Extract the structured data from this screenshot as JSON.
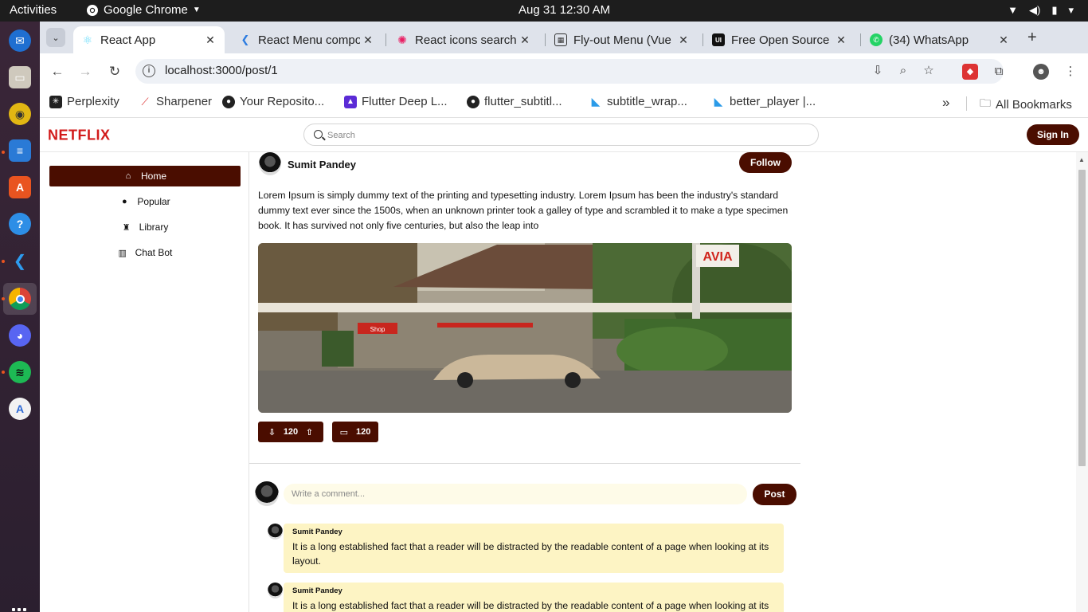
{
  "os": {
    "activities": "Activities",
    "app_name": "Google Chrome",
    "clock": "Aug 31  12:30 AM"
  },
  "browser": {
    "tabs": [
      {
        "title": "React App",
        "icon": "react-icon",
        "active": true
      },
      {
        "title": "React Menu compo",
        "icon": "vscode-icon",
        "active": false
      },
      {
        "title": "React icons search",
        "icon": "react-icons-icon",
        "active": false
      },
      {
        "title": "Fly-out Menu (Vue",
        "icon": "grid-icon",
        "active": false
      },
      {
        "title": "Free Open Source",
        "icon": "ui-icon",
        "active": false
      },
      {
        "title": "(34) WhatsApp",
        "icon": "whatsapp-icon",
        "active": false
      }
    ],
    "url": "localhost:3000/post/1",
    "bookmarks": [
      {
        "label": "Perplexity",
        "icon": "perplexity-icon"
      },
      {
        "label": "Sharpener",
        "icon": "sharpener-icon"
      },
      {
        "label": "Your Reposito...",
        "icon": "github-icon"
      },
      {
        "label": "Flutter Deep L...",
        "icon": "flutter-icon"
      },
      {
        "label": "flutter_subtitl...",
        "icon": "github-icon"
      },
      {
        "label": "subtitle_wrap...",
        "icon": "flutter-icon"
      },
      {
        "label": "better_player |...",
        "icon": "flutter-icon"
      }
    ],
    "all_bookmarks": "All Bookmarks"
  },
  "app": {
    "logo": "NETFLIX",
    "search_placeholder": "Search",
    "sign_in": "Sign In",
    "nav": [
      {
        "label": "Home",
        "icon": "home-icon",
        "active": true
      },
      {
        "label": "Popular",
        "icon": "compass-icon",
        "active": false
      },
      {
        "label": "Library",
        "icon": "library-icon",
        "active": false
      },
      {
        "label": "Chat Bot",
        "icon": "chart-icon",
        "active": false
      }
    ],
    "post": {
      "author": "Sumit Pandey",
      "follow": "Follow",
      "text": "Lorem Ipsum is simply dummy text of the printing and typesetting industry. Lorem Ipsum has been the industry's standard dummy text ever since the 1500s, when an unknown printer took a galley of type and scrambled it to make a type specimen book. It has survived not only five centuries, but also the leap into",
      "image_sign": "AVIA",
      "image_shop": "Shop",
      "votes": "120",
      "comments_count": "120"
    },
    "comment_placeholder": "Write a comment...",
    "post_button": "Post",
    "comments": [
      {
        "author": "Sumit Pandey",
        "text": "It is a long established fact that a reader will be distracted by the readable content of a page when looking at its layout."
      },
      {
        "author": "Sumit Pandey",
        "text": "It is a long established fact that a reader will be distracted by the readable content of a page when looking at its layout."
      }
    ]
  },
  "colors": {
    "brand_dark": "#4a0d00",
    "logo_red": "#d21b1b",
    "comment_bg": "#fdf4c4"
  }
}
